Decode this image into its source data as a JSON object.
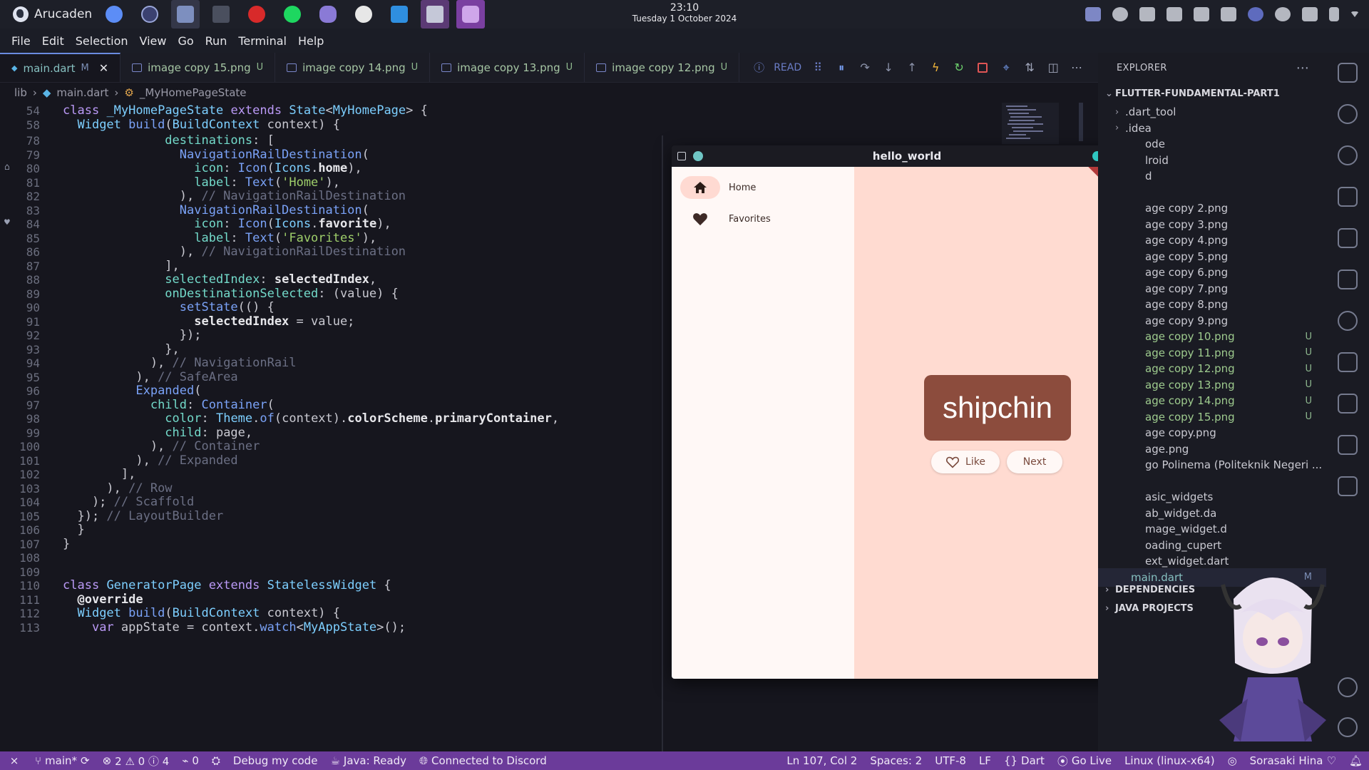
{
  "system": {
    "os_name": "Arucaden",
    "clock_time": "23:10",
    "clock_date": "Tuesday 1 October 2024"
  },
  "menu": [
    "File",
    "Edit",
    "Selection",
    "View",
    "Go",
    "Run",
    "Terminal",
    "Help"
  ],
  "tabs": [
    {
      "label": "main.dart",
      "badge": "M",
      "active": true
    },
    {
      "label": "image copy 15.png",
      "badge": "U"
    },
    {
      "label": "image copy 14.png",
      "badge": "U"
    },
    {
      "label": "image copy 13.png",
      "badge": "U"
    },
    {
      "label": "image copy 12.png",
      "badge": "U"
    }
  ],
  "debug_label": "READ",
  "breadcrumb": [
    "lib",
    "main.dart",
    "_MyHomePageState"
  ],
  "sticky": [
    {
      "n": "54",
      "html": "<span class='kw'>class</span> <span class='ty'>_MyHomePageState</span> <span class='kw'>extends</span> <span class='ty'>State</span>&lt;<span class='ty'>MyHomePage</span>&gt; {"
    },
    {
      "n": "58",
      "html": "  <span class='ty'>Widget</span> <span class='fn'>build</span>(<span class='ty'>BuildContext</span> context) {"
    }
  ],
  "code": [
    {
      "n": "78",
      "html": "              <span class='pr'>destinations</span>: ["
    },
    {
      "n": "79",
      "html": "                <span class='fn'>NavigationRailDestination</span>("
    },
    {
      "n": "80",
      "html": "                  <span class='pr'>icon</span>: <span class='fn'>Icon</span>(<span class='ty'>Icons</span>.<span class='bd'>home</span>),"
    },
    {
      "n": "81",
      "html": "                  <span class='pr'>label</span>: <span class='fn'>Text</span>(<span class='st'>'Home'</span>),"
    },
    {
      "n": "82",
      "html": "                ), <span class='cm'>// NavigationRailDestination</span>"
    },
    {
      "n": "83",
      "html": "                <span class='fn'>NavigationRailDestination</span>("
    },
    {
      "n": "84",
      "html": "                  <span class='pr'>icon</span>: <span class='fn'>Icon</span>(<span class='ty'>Icons</span>.<span class='bd'>favorite</span>),"
    },
    {
      "n": "85",
      "html": "                  <span class='pr'>label</span>: <span class='fn'>Text</span>(<span class='st'>'Favorites'</span>),"
    },
    {
      "n": "86",
      "html": "                ), <span class='cm'>// NavigationRailDestination</span>"
    },
    {
      "n": "87",
      "html": "              ],"
    },
    {
      "n": "88",
      "html": "              <span class='pr'>selectedIndex</span>: <span class='bd'>selectedIndex</span>,"
    },
    {
      "n": "89",
      "html": "              <span class='pr'>onDestinationSelected</span>: (value) {"
    },
    {
      "n": "90",
      "html": "                <span class='fn'>setState</span>(() {"
    },
    {
      "n": "91",
      "html": "                  <span class='bd'>selectedIndex</span> = value;"
    },
    {
      "n": "92",
      "html": "                });"
    },
    {
      "n": "93",
      "html": "              },"
    },
    {
      "n": "94",
      "html": "            ), <span class='cm'>// NavigationRail</span>"
    },
    {
      "n": "95",
      "html": "          ), <span class='cm'>// SafeArea</span>"
    },
    {
      "n": "96",
      "html": "          <span class='fn'>Expanded</span>("
    },
    {
      "n": "97",
      "html": "            <span class='pr'>child</span>: <span class='fn'>Container</span>("
    },
    {
      "n": "98",
      "html": "              <span class='pr'>color</span>: <span class='ty'>Theme</span>.<span class='fn'>of</span>(context).<span class='bd'>colorScheme</span>.<span class='bd'>primaryContainer</span>,"
    },
    {
      "n": "99",
      "html": "              <span class='pr'>child</span>: page,"
    },
    {
      "n": "100",
      "html": "            ), <span class='cm'>// Container</span>"
    },
    {
      "n": "101",
      "html": "          ), <span class='cm'>// Expanded</span>"
    },
    {
      "n": "102",
      "html": "        ],"
    },
    {
      "n": "103",
      "html": "      ), <span class='cm'>// Row</span>"
    },
    {
      "n": "104",
      "html": "    ); <span class='cm'>// Scaffold</span>"
    },
    {
      "n": "105",
      "html": "  }); <span class='cm'>// LayoutBuilder</span>"
    },
    {
      "n": "106",
      "html": "  }"
    },
    {
      "n": "107",
      "html": "}"
    },
    {
      "n": "108",
      "html": ""
    },
    {
      "n": "109",
      "html": ""
    },
    {
      "n": "110",
      "html": "<span class='kw'>class</span> <span class='ty'>GeneratorPage</span> <span class='kw'>extends</span> <span class='ty'>StatelessWidget</span> {"
    },
    {
      "n": "111",
      "html": "  <span class='bd'>@override</span>"
    },
    {
      "n": "112",
      "html": "  <span class='ty'>Widget</span> <span class='fn'>build</span>(<span class='ty'>BuildContext</span> context) {"
    },
    {
      "n": "113",
      "html": "    <span class='kw'>var</span> appState = context.<span class='fn'>watch</span>&lt;<span class='ty'>MyAppState</span>&gt;();"
    }
  ],
  "flutter": {
    "title": "hello_world",
    "ribbon": "DEBUG",
    "rail_home": "Home",
    "rail_favorites": "Favorites",
    "word": "shipchin",
    "like": "Like",
    "next": "Next"
  },
  "explorer": {
    "title": "EXPLORER",
    "project": "FLUTTER-FUNDAMENTAL-PART1",
    "items": [
      {
        "label": ".dart_tool",
        "folder": true
      },
      {
        "label": ".idea",
        "folder": true
      },
      {
        "label": "ode"
      },
      {
        "label": "lroid"
      },
      {
        "label": "d"
      },
      {
        "label": ""
      },
      {
        "label": "age copy 2.png"
      },
      {
        "label": "age copy 3.png"
      },
      {
        "label": "age copy 4.png"
      },
      {
        "label": "age copy 5.png"
      },
      {
        "label": "age copy 6.png"
      },
      {
        "label": "age copy 7.png"
      },
      {
        "label": "age copy 8.png"
      },
      {
        "label": "age copy 9.png"
      },
      {
        "label": "age copy 10.png",
        "u": "U"
      },
      {
        "label": "age copy 11.png",
        "u": "U"
      },
      {
        "label": "age copy 12.png",
        "u": "U"
      },
      {
        "label": "age copy 13.png",
        "u": "U"
      },
      {
        "label": "age copy 14.png",
        "u": "U"
      },
      {
        "label": "age copy 15.png",
        "u": "U"
      },
      {
        "label": "age copy.png"
      },
      {
        "label": "age.png"
      },
      {
        "label": "go Polinema (Politeknik Negeri ..."
      },
      {
        "label": ""
      },
      {
        "label": "asic_widgets"
      },
      {
        "label": "ab_widget.da"
      },
      {
        "label": "mage_widget.d"
      },
      {
        "label": "oading_cupert"
      },
      {
        "label": "ext_widget.dart"
      },
      {
        "label": "main.dart",
        "u": "M"
      }
    ],
    "dependencies": "DEPENDENCIES",
    "java_projects": "JAVA PROJECTS"
  },
  "status": {
    "branch": "main*",
    "problems": "2 ⚠ 0 ⓘ 4",
    "ports": "0",
    "debug": "Debug my code",
    "java": "Java: Ready",
    "discord": "Connected to Discord",
    "position": "Ln 107, Col 2",
    "spaces": "Spaces: 2",
    "encoding": "UTF-8",
    "eol": "LF",
    "lang": "Dart",
    "golive": "Go Live",
    "platform": "Linux (linux-x64)",
    "user": "Sorasaki Hina"
  }
}
